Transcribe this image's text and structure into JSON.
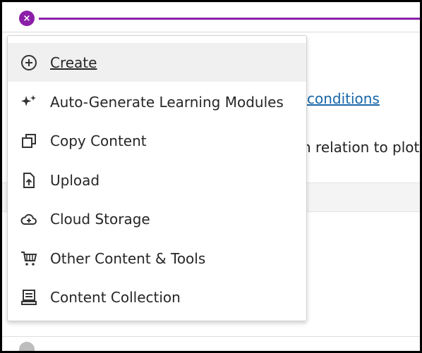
{
  "header": {
    "close_label": "×",
    "accent_color": "#8b1fa8"
  },
  "background": {
    "link_text": "conditions",
    "paragraph_fragment": "n relation to plot,"
  },
  "menu": {
    "items": [
      {
        "label": "Create",
        "icon": "plus-circle-icon",
        "active": true
      },
      {
        "label": "Auto-Generate Learning Modules",
        "icon": "sparkle-icon",
        "active": false
      },
      {
        "label": "Copy Content",
        "icon": "copy-icon",
        "active": false
      },
      {
        "label": "Upload",
        "icon": "upload-file-icon",
        "active": false
      },
      {
        "label": "Cloud Storage",
        "icon": "cloud-add-icon",
        "active": false
      },
      {
        "label": "Other Content & Tools",
        "icon": "cart-icon",
        "active": false
      },
      {
        "label": "Content Collection",
        "icon": "collection-icon",
        "active": false
      }
    ]
  }
}
